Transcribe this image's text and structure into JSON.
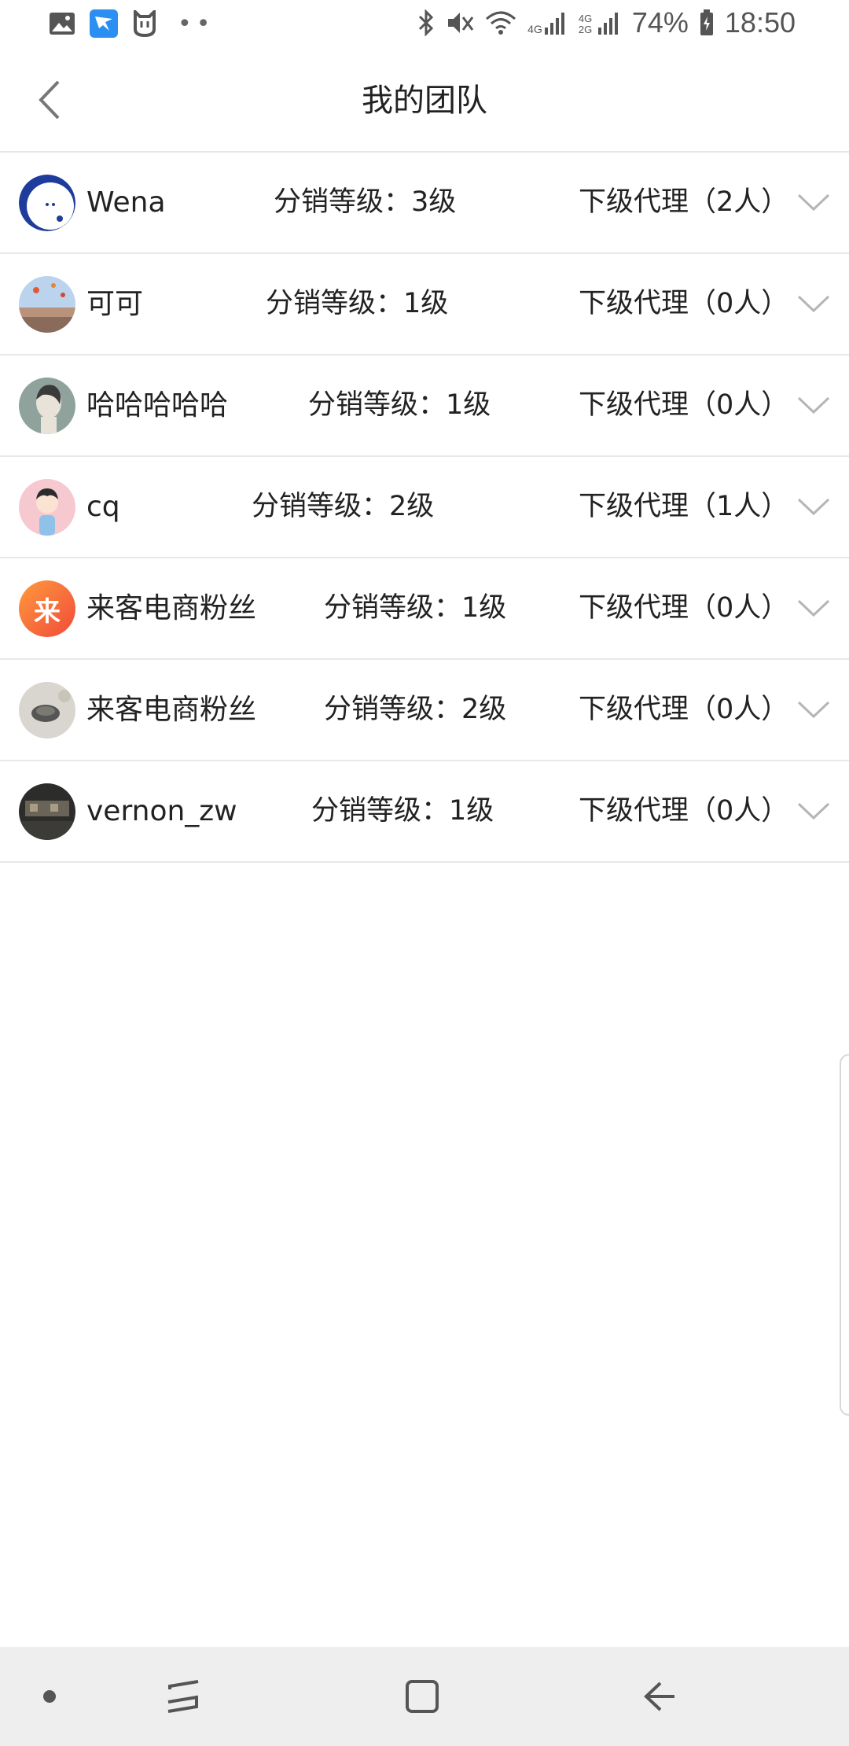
{
  "status_bar": {
    "battery": "74%",
    "time": "18:50",
    "network_1": "4G",
    "network_2": "4G 2G"
  },
  "header": {
    "title": "我的团队"
  },
  "members": [
    {
      "name": "Wena",
      "level": "分销等级：3级",
      "sub_agents": "下级代理（2人）"
    },
    {
      "name": "可可",
      "level": "分销等级：1级",
      "sub_agents": "下级代理（0人）"
    },
    {
      "name": "哈哈哈哈哈",
      "level": "分销等级：1级",
      "sub_agents": "下级代理（0人）"
    },
    {
      "name": "cq",
      "level": "分销等级：2级",
      "sub_agents": "下级代理（1人）"
    },
    {
      "name": "来客电商粉丝",
      "level": "分销等级：1级",
      "sub_agents": "下级代理（0人）"
    },
    {
      "name": "来客电商粉丝",
      "level": "分销等级：2级",
      "sub_agents": "下级代理（0人）"
    },
    {
      "name": "vernon_zw",
      "level": "分销等级：1级",
      "sub_agents": "下级代理（0人）"
    }
  ],
  "avatar_5_glyph": "来",
  "icons": {
    "back": "chevron-left-icon",
    "expand": "chevron-down-icon",
    "nav_recent": "recent-apps-icon",
    "nav_home": "home-icon",
    "nav_back": "back-arrow-icon"
  },
  "colors": {
    "divider": "#e8e8e8",
    "navbar": "#eeeeee",
    "text": "#222222"
  }
}
